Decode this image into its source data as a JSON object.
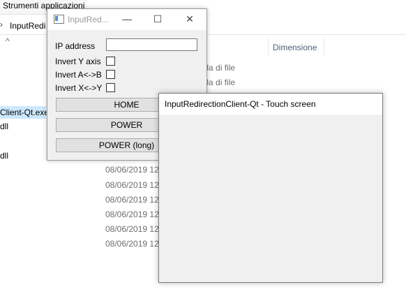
{
  "explorer": {
    "ribbon_tab": "Strumenti applicazioni",
    "address": "InputRedi",
    "column_header": "Dimensione",
    "row_types": [
      "ella di file",
      "ella di file"
    ],
    "left_items": [
      "Client-Qt.exe",
      "dll",
      "dll"
    ],
    "dates": [
      "08/06/2019 12:",
      "08/06/2019 12:",
      "08/06/2019 12:",
      "08/06/2019 12:",
      "08/06/2019 12:",
      "08/06/2019 12:",
      "08/06/2019 12:"
    ]
  },
  "small_window": {
    "title": "InputRed...",
    "minimize_glyph": "—",
    "maximize_glyph": "☐",
    "close_glyph": "✕",
    "ip_label": "IP address",
    "ip_value": "",
    "invert_y_label": "Invert Y axis",
    "invert_ab_label": "Invert A<->B",
    "invert_xy_label": "Invert X<->Y",
    "invert_y_checked": false,
    "invert_ab_checked": false,
    "invert_xy_checked": false,
    "home_label": "HOME",
    "power_label": "POWER",
    "power_long_label": "POWER (long)"
  },
  "touch_window": {
    "title": "InputRedirectionClient-Qt - Touch screen"
  }
}
